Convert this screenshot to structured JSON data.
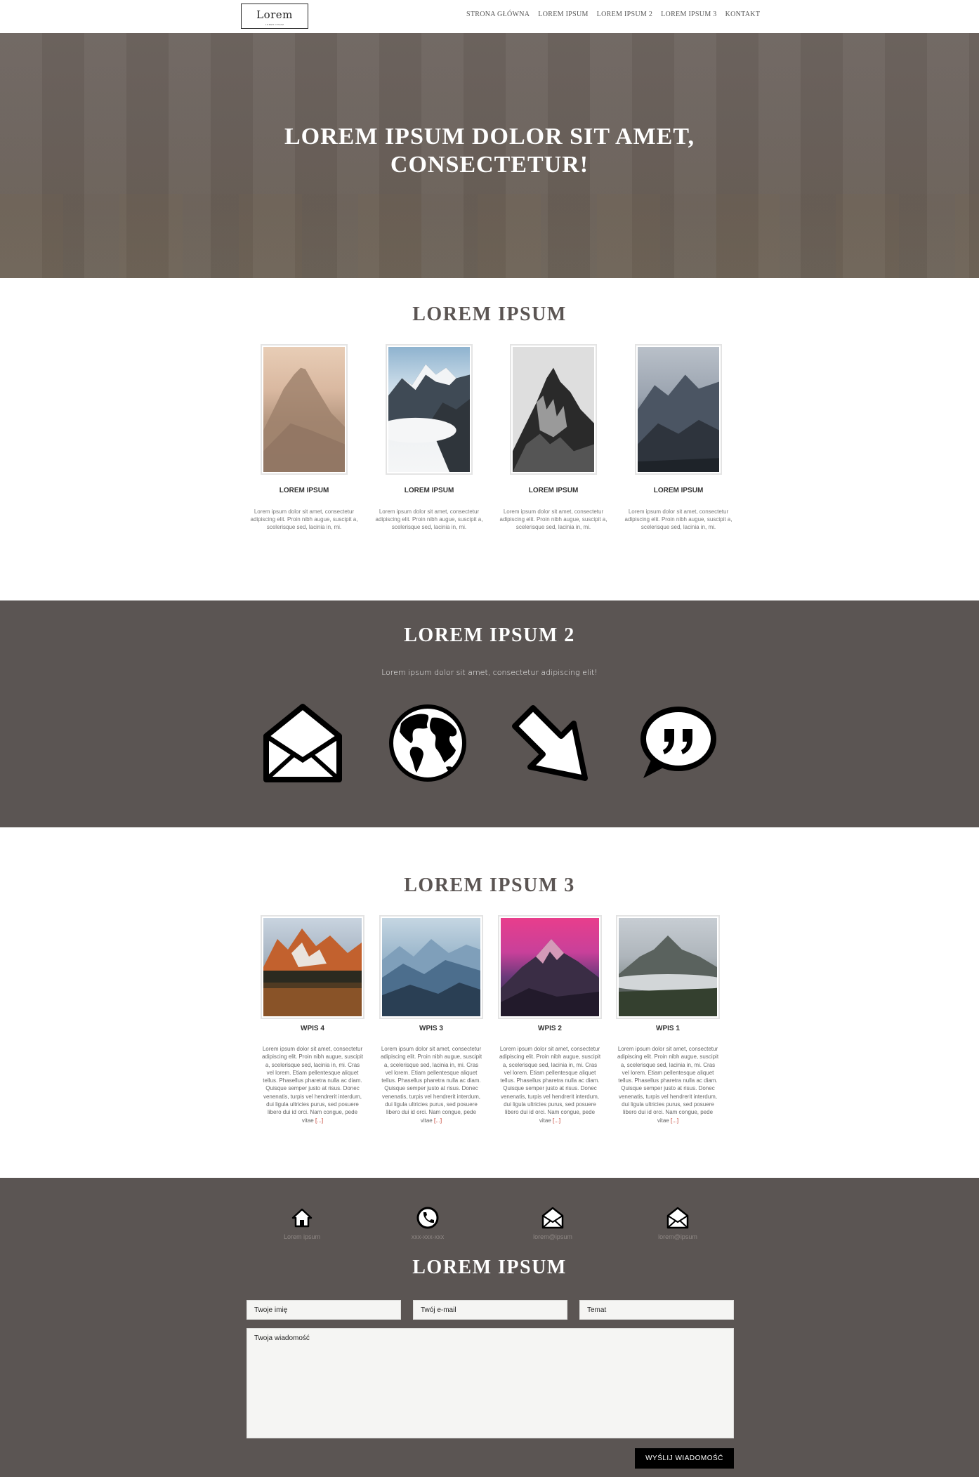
{
  "header": {
    "logo_title": "Lorem",
    "logo_subtitle": "LOREM IPSUM",
    "nav": [
      "STRONA GŁÓWNA",
      "LOREM IPSUM",
      "LOREM IPSUM 2",
      "LOREM IPSUM 3",
      "KONTAKT"
    ]
  },
  "hero": {
    "title_line1": "LOREM IPSUM DOLOR SIT AMET,",
    "title_line2": "CONSECTETUR!"
  },
  "section1": {
    "title": "LOREM IPSUM",
    "cards": [
      {
        "label": "LOREM IPSUM",
        "text": "Lorem ipsum dolor sit amet, consectetur adipiscing elit. Proin nibh augue, suscipit a, scelerisque sed, lacinia in, mi."
      },
      {
        "label": "LOREM IPSUM",
        "text": "Lorem ipsum dolor sit amet, consectetur adipiscing elit. Proin nibh augue, suscipit a, scelerisque sed, lacinia in, mi."
      },
      {
        "label": "LOREM IPSUM",
        "text": "Lorem ipsum dolor sit amet, consectetur adipiscing elit. Proin nibh augue, suscipit a, scelerisque sed, lacinia in, mi."
      },
      {
        "label": "LOREM IPSUM",
        "text": "Lorem ipsum dolor sit amet, consectetur adipiscing elit. Proin nibh augue, suscipit a, scelerisque sed, lacinia in, mi."
      }
    ]
  },
  "section2": {
    "title": "LOREM IPSUM 2",
    "subtitle": "Lorem ipsum dolor sit amet, consectetur adipiscing elit!",
    "icons": [
      "envelope-icon",
      "globe-icon",
      "arrow-down-right-icon",
      "quote-bubble-icon"
    ]
  },
  "section3": {
    "title": "LOREM IPSUM 3",
    "posts": [
      {
        "label": "WPIS 4",
        "text": "Lorem ipsum dolor sit amet, consectetur adipiscing elit. Proin nibh augue, suscipit a, scelerisque sed, lacinia in, mi. Cras vel lorem. Etiam pellentesque aliquet tellus. Phasellus pharetra nulla ac diam. Quisque semper justo at risus. Donec venenatis, turpis vel hendrerit interdum, dui ligula ultricies purus, sed posuere libero dui id orci. Nam congue, pede vitae",
        "more": "[...]"
      },
      {
        "label": "WPIS 3",
        "text": "Lorem ipsum dolor sit amet, consectetur adipiscing elit. Proin nibh augue, suscipit a, scelerisque sed, lacinia in, mi. Cras vel lorem. Etiam pellentesque aliquet tellus. Phasellus pharetra nulla ac diam. Quisque semper justo at risus. Donec venenatis, turpis vel hendrerit interdum, dui ligula ultricies purus, sed posuere libero dui id orci. Nam congue, pede vitae",
        "more": "[...]"
      },
      {
        "label": "WPIS 2",
        "text": "Lorem ipsum dolor sit amet, consectetur adipiscing elit. Proin nibh augue, suscipit a, scelerisque sed, lacinia in, mi. Cras vel lorem. Etiam pellentesque aliquet tellus. Phasellus pharetra nulla ac diam. Quisque semper justo at risus. Donec venenatis, turpis vel hendrerit interdum, dui ligula ultricies purus, sed posuere libero dui id orci. Nam congue, pede vitae",
        "more": "[...]"
      },
      {
        "label": "WPIS 1",
        "text": "Lorem ipsum dolor sit amet, consectetur adipiscing elit. Proin nibh augue, suscipit a, scelerisque sed, lacinia in, mi. Cras vel lorem. Etiam pellentesque aliquet tellus. Phasellus pharetra nulla ac diam. Quisque semper justo at risus. Donec venenatis, turpis vel hendrerit interdum, dui ligula ultricies purus, sed posuere libero dui id orci. Nam congue, pede vitae",
        "more": "[...]"
      }
    ]
  },
  "footer": {
    "contacts": [
      {
        "icon": "home-icon",
        "label": "Lorem ipsum"
      },
      {
        "icon": "phone-icon",
        "label": "xxx-xxx-xxx"
      },
      {
        "icon": "envelope-icon",
        "label": "lorem@ipsum"
      },
      {
        "icon": "envelope-icon",
        "label": "lorem@ipsum"
      }
    ],
    "title": "LOREM IPSUM",
    "form": {
      "name_placeholder": "Twoje imię",
      "email_placeholder": "Twój e-mail",
      "subject_placeholder": "Temat",
      "message_placeholder": "Twoja wiadomość",
      "submit_label": "WYŚLIJ WIADOMOŚĆ"
    }
  },
  "colors": {
    "dark_bg": "#5b5553",
    "hero_bg": "#6b625c",
    "accent_link": "#c0392b",
    "button_bg": "#000000"
  }
}
